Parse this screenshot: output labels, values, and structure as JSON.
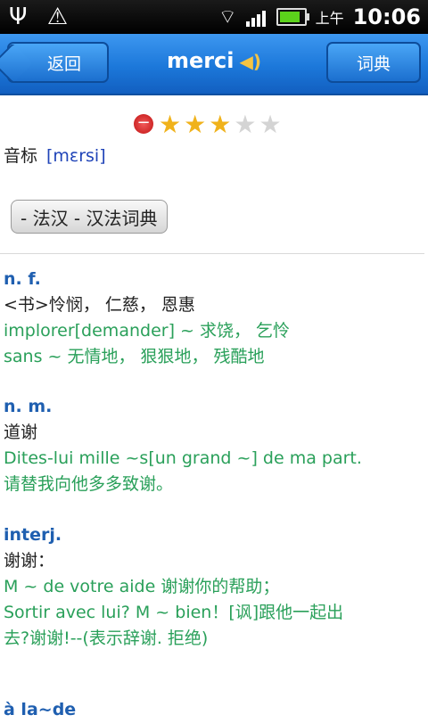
{
  "status_bar": {
    "usb_icon": "usb-icon",
    "alert_icon": "warning-icon",
    "ampm": "上午",
    "time": "10:06"
  },
  "header": {
    "back_label": "返回",
    "title": "merci",
    "dict_label": "词典"
  },
  "rating": {
    "stars": 3,
    "max": 5
  },
  "phonetic": {
    "label": "音标",
    "ipa": "[mɛrsi]"
  },
  "dictionary_tag": "- 法汉 - 汉法词典",
  "entries": [
    {
      "pos": "n. f.",
      "lines": [
        {
          "type": "def",
          "text": "<书>怜悯， 仁慈， 恩惠"
        },
        {
          "type": "ex",
          "text": "implorer[demander] ~ 求饶， 乞怜"
        },
        {
          "type": "ex",
          "text": "sans ~ 无情地， 狠狠地， 残酷地"
        }
      ]
    },
    {
      "pos": "n. m.",
      "lines": [
        {
          "type": "def",
          "text": "道谢"
        },
        {
          "type": "ex",
          "text": "Dites-lui mille ~s[un grand ~] de ma part."
        },
        {
          "type": "ex",
          "text": "请替我向他多多致谢。"
        }
      ]
    },
    {
      "pos": "interj.",
      "lines": [
        {
          "type": "def",
          "text": "谢谢："
        },
        {
          "type": "ex",
          "text": "M ~ de votre aide 谢谢你的帮助；"
        },
        {
          "type": "ex",
          "text": "Sortir avec lui? M ~ bien！[讽]跟他一起出"
        },
        {
          "type": "ex",
          "text": "去?谢谢!--(表示辞谢. 拒绝)"
        }
      ]
    },
    {
      "pos": "à la~de",
      "lines": []
    }
  ],
  "colors": {
    "header_blue": "#1c78da",
    "pos_blue": "#1f5fb0",
    "example_green": "#2aa05a",
    "star_gold": "#f0b21b"
  }
}
